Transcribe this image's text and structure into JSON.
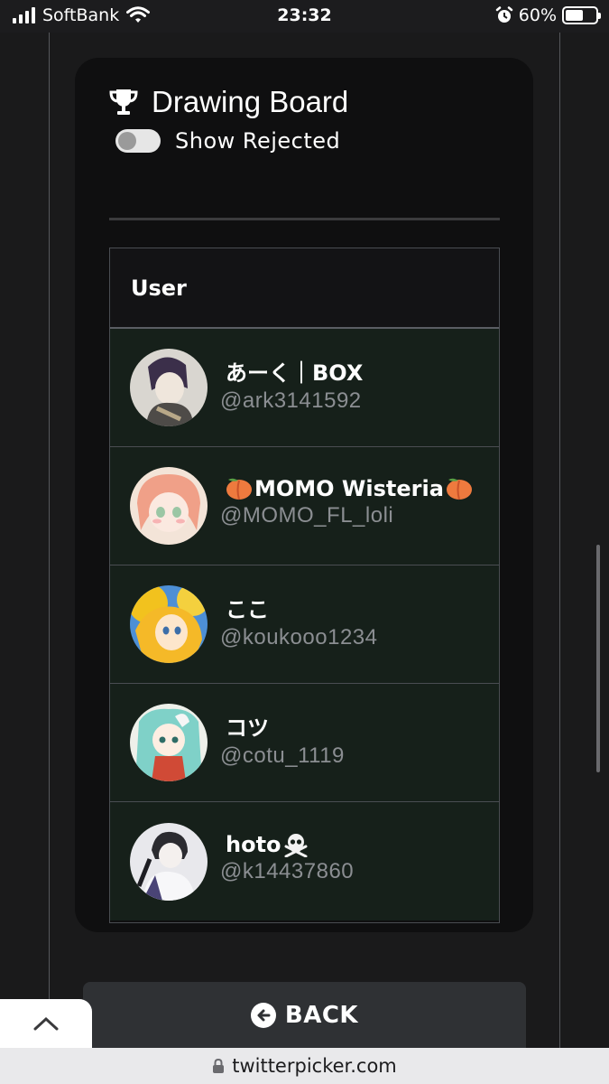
{
  "status_bar": {
    "carrier": "SoftBank",
    "time": "23:32",
    "battery": "60%",
    "battery_level": 0.6
  },
  "panel": {
    "title": "Drawing Board",
    "toggle_label": "Show Rejected",
    "toggle_on": false
  },
  "table": {
    "column_header": "User",
    "rows": [
      {
        "name": "あーく｜BOX",
        "handle": "@ark3141592"
      },
      {
        "name": "MOMO Wisteria",
        "handle": "@MOMO_FL_loli"
      },
      {
        "name": "ここ",
        "handle": "@koukooo1234"
      },
      {
        "name": "コツ",
        "handle": "@cotu_1119"
      },
      {
        "name": "hoto",
        "handle": "@k14437860"
      }
    ]
  },
  "back_button": {
    "label": "BACK"
  },
  "url_bar": {
    "domain": "twitterpicker.com"
  }
}
